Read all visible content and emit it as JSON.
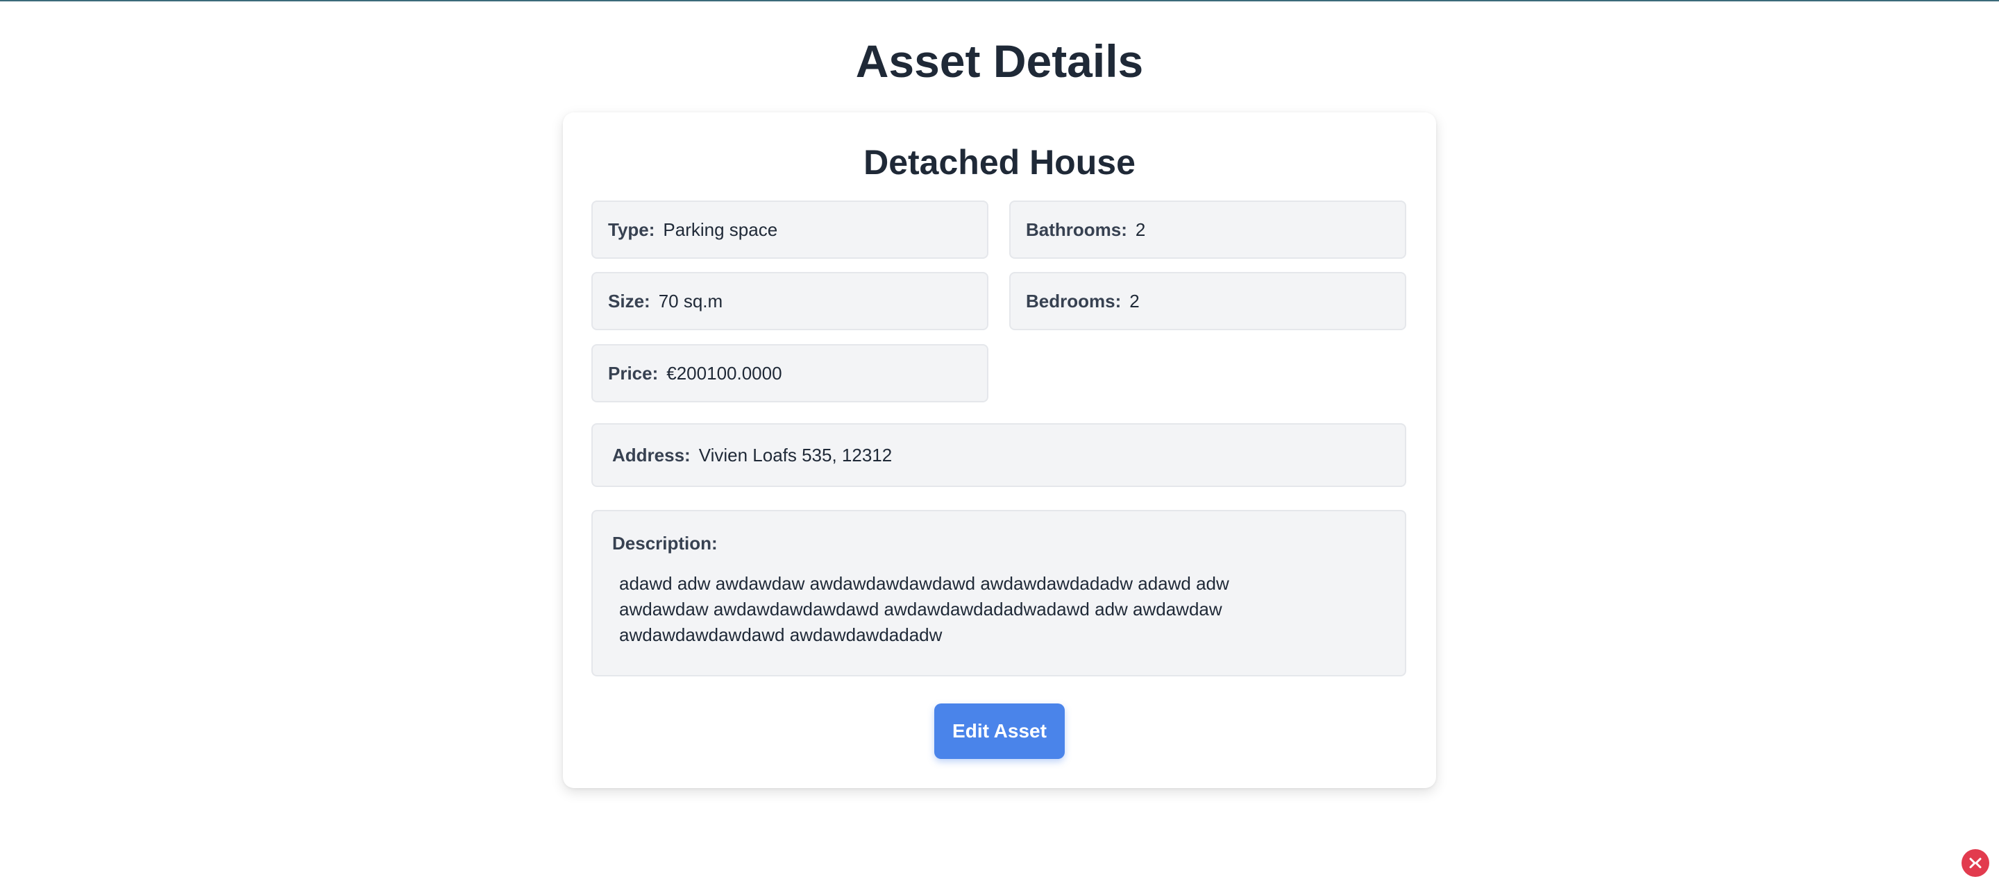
{
  "page": {
    "title": "Asset Details"
  },
  "asset": {
    "name": "Detached House",
    "type_label": "Type:",
    "type_value": "Parking space",
    "bathrooms_label": "Bathrooms:",
    "bathrooms_value": "2",
    "size_label": "Size:",
    "size_value": "70 sq.m",
    "bedrooms_label": "Bedrooms:",
    "bedrooms_value": "2",
    "price_label": "Price:",
    "price_value": "€200100.0000",
    "address_label": "Address:",
    "address_value": "Vivien Loafs 535, 12312",
    "description_label": "Description:",
    "description_value": "adawd adw awdawdaw awdawdawdawdawd awdawdawdadadw adawd adw awdawdaw awdawdawdawdawd awdawdawdadadwadawd adw awdawdaw awdawdawdawdawd awdawdawdadadw"
  },
  "actions": {
    "edit_label": "Edit Asset"
  },
  "icons": {
    "corner_badge": "x-badge-icon"
  },
  "colors": {
    "accent": "#4a84ea",
    "badge": "#e23b4e"
  }
}
